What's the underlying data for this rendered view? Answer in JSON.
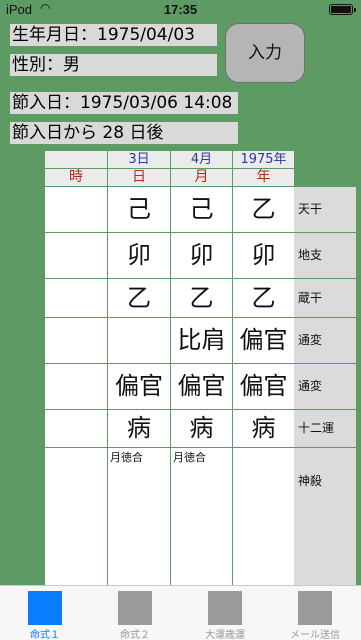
{
  "status": {
    "carrier": "iPod",
    "time": "17:35"
  },
  "fields": {
    "birth": "生年月日：1975/04/03",
    "sex": "性別：男",
    "setsunyu": "節入日：1975/03/06 14:08",
    "days_after": "節入日から 28 日後"
  },
  "input_button": "入力",
  "header_dates": {
    "day": "3日",
    "month": "4月",
    "year": "1975年"
  },
  "pillars": {
    "hour": "時",
    "day": "日",
    "month": "月",
    "year": "年"
  },
  "rows": [
    {
      "label": "天干",
      "day": "己",
      "month": "己",
      "year": "乙"
    },
    {
      "label": "地支",
      "day": "卯",
      "month": "卯",
      "year": "卯"
    },
    {
      "label": "蔵干",
      "day": "乙",
      "month": "乙",
      "year": "乙"
    },
    {
      "label": "通変",
      "day": "",
      "month": "比肩",
      "year": "偏官"
    },
    {
      "label": "通変",
      "day": "偏官",
      "month": "偏官",
      "year": "偏官"
    },
    {
      "label": "十二運",
      "day": "病",
      "month": "病",
      "year": "病"
    },
    {
      "label": "神殺",
      "day": "月徳合",
      "month": "月徳合",
      "year": ""
    }
  ],
  "tabs": [
    {
      "label": "命式１",
      "active": true
    },
    {
      "label": "命式２",
      "active": false
    },
    {
      "label": "大運歳運",
      "active": false
    },
    {
      "label": "メール送信",
      "active": false
    }
  ]
}
